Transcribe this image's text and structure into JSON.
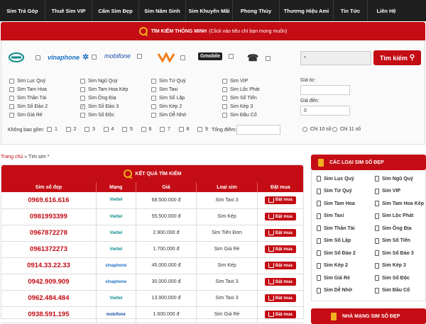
{
  "nav": [
    "Sim Trả Góp",
    "Thuê Sim VIP",
    "Cẩm Sim Đẹp",
    "Sim Năm Sinh",
    "Sim Khuyến Mãi",
    "Phong Thủy",
    "Thương Hiệu Ami",
    "Tin Tức",
    "Liên Hệ"
  ],
  "search": {
    "title": "TÌM KIẾM THÔNG MINH",
    "subtitle": "(Click vào tiêu chí bạn mong muốn)",
    "keyword": "*",
    "button": "Tìm kiếm",
    "carriers": [
      "Viettel",
      "vinaphone",
      "mobifone",
      "Vietnamobile",
      "Gmobile",
      "Máy bàn"
    ],
    "types": [
      [
        "Sim Lục Quý",
        "Sim Ngũ Quý",
        "Sim Tứ Quý",
        "Sim VIP"
      ],
      [
        "Sim Tam Hoa",
        "Sim Tam Hoa Kép",
        "Sim Taxi",
        "Sim Lộc Phát"
      ],
      [
        "Sim Thần Tài",
        "Sim Ông Địa",
        "Sim Số Lặp",
        "Sim Số Tiến"
      ],
      [
        "Sim Số Đảo 2",
        "Sim Số Đảo 3",
        "Sim Kép 2",
        "Sim Kép 3"
      ],
      [
        "Sim Giá Rẻ",
        "Sim Số Độc",
        "Sim Dễ Nhớ",
        "Sim Đầu Cổ"
      ]
    ],
    "checked": "Sim Số Đảo 3",
    "exclude_label": "Không bao gồm:",
    "exclude_digits": [
      "1",
      "2",
      "3",
      "4",
      "5",
      "6",
      "7",
      "8",
      "9"
    ],
    "sum_label": "Tổng điểm:",
    "price_from": "Giá từ:",
    "price_to": "Giá đến:",
    "price_to_value": "0",
    "radio1": "Chỉ 10 số",
    "radio2": "Chỉ 11 số"
  },
  "breadcrumb": {
    "home": "Trang chủ",
    "sep": " » ",
    "current": "Tìm sim *"
  },
  "results": {
    "title": "KẾT QUẢ TÌM KIẾM",
    "headers": [
      "Sim số đẹp",
      "Mạng",
      "Giá",
      "Loại sim",
      "Đặt mua"
    ],
    "buy_label": "Đặt mua",
    "rows": [
      {
        "num": "0969.616.616",
        "net": "Viettel",
        "price": "68.500.000 đ",
        "type": "Sim Taxi 3"
      },
      {
        "num": "0981993399",
        "net": "Viettel",
        "price": "55.500.000 đ",
        "type": "Sim Kép"
      },
      {
        "num": "0967872278",
        "net": "Viettel",
        "price": "2.900.000 đ",
        "type": "Sim Tiến Đơn"
      },
      {
        "num": "0961372273",
        "net": "Viettel",
        "price": "1.700.000 đ",
        "type": "Sim Giá Rẻ"
      },
      {
        "num": "0914.33.22.33",
        "net": "vinaphone",
        "price": "45.000.000 đ",
        "type": "Sim Kép"
      },
      {
        "num": "0942.909.909",
        "net": "vinaphone",
        "price": "30.000.000 đ",
        "type": "Sim Taxi 3"
      },
      {
        "num": "0962.484.484",
        "net": "Viettel",
        "price": "13.900.000 đ",
        "type": "Sim Taxi 3"
      },
      {
        "num": "0938.591.195",
        "net": "mobifone",
        "price": "1.600.000 đ",
        "type": "Sim Giá Rẻ"
      }
    ]
  },
  "sidebar": {
    "title": "CÁC LOẠI SIM SỐ ĐẸP",
    "items": [
      [
        "Sim Lục Quý",
        "Sim Ngũ Quý"
      ],
      [
        "Sim Tứ Quý",
        "Sim VIP"
      ],
      [
        "Sim Tam Hoa",
        "Sim Tam Hoa Kép"
      ],
      [
        "Sim Taxi",
        "Sim Lộc Phát"
      ],
      [
        "Sim Thần Tài",
        "Sim Ông Địa"
      ],
      [
        "Sim Số Lặp",
        "Sim Số Tiến"
      ],
      [
        "Sim Số Đảo 2",
        "Sim Số Đảo 3"
      ],
      [
        "Sim Kép 2",
        "Sim Kép 3"
      ],
      [
        "Sim Giá Rẻ",
        "Sim Số Độc"
      ],
      [
        "Sim Dễ Nhớ",
        "Sim Đầu Cổ"
      ]
    ],
    "title2": "NHÀ MẠNG SIM SỐ ĐẸP"
  },
  "colors": {
    "accent": "#c40c14",
    "nav": "#1f1f1f",
    "icon": "#f2b01e",
    "viettel": "#0a8a8a",
    "vina": "#1d6fc4",
    "mobi": "#1a4aa8",
    "vnmobile": "#f07f1a"
  }
}
